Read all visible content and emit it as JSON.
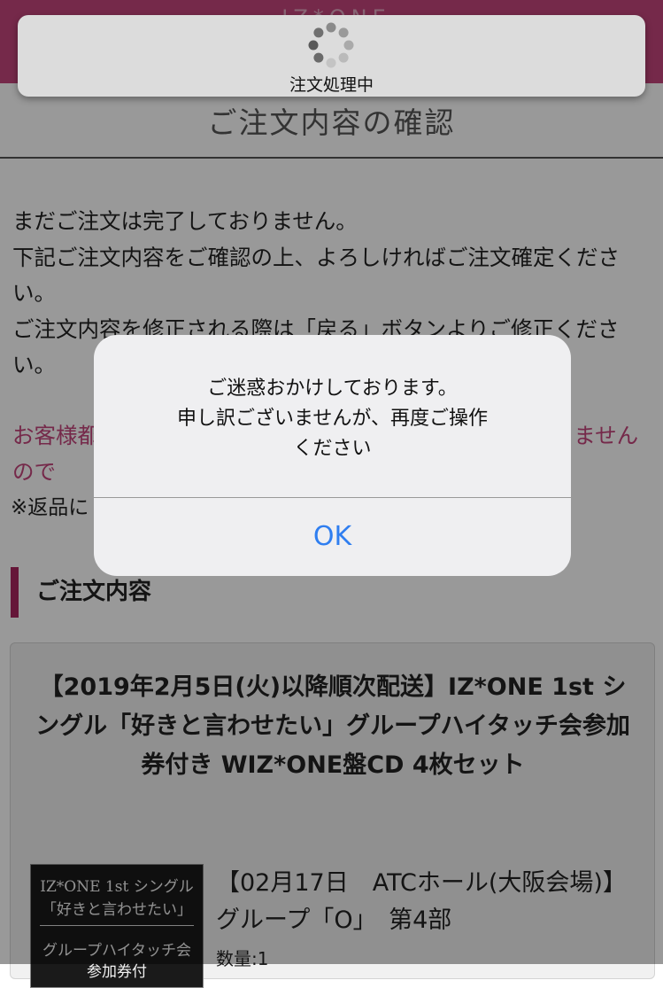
{
  "page": {
    "title": "ご注文内容の確認",
    "notice_lines": [
      "まだご注文は完了しておりません。",
      "下記ご注文内容をご確認の上、よろしければご注文確定ください。",
      "ご注文内容を修正される際は「戻る」ボタンよりご修正ください。"
    ],
    "warning_text": "お客様都合によるご注文の変更・キャンセルは承っておりませんので",
    "return_note": "※返品に",
    "section_heading": "ご注文内容"
  },
  "product": {
    "title": "【2019年2月5日(火)以降順次配送】IZ*ONE 1st シングル「好きと言わせたい」グループハイタッチ会参加券付き WIZ*ONE盤CD 4枚セット",
    "thumbnail_lines": [
      "IZ*ONE 1st シングル",
      "「好きと言わせたい」",
      "グループハイタッチ会",
      "参加券付"
    ],
    "event": "【02月17日　ATCホール(大阪会場)】グループ「O」　第4部",
    "quantity_label": "数量:",
    "quantity_value": "1"
  },
  "processing": {
    "label": "注文処理中",
    "icon": "spinner-icon"
  },
  "alert": {
    "message_lines": [
      "ご迷惑おかけしております。",
      "申し訳ございませんが、再度ご操作",
      "ください"
    ],
    "ok_label": "OK"
  },
  "colors": {
    "brand_pink": "#c4457c",
    "section_accent": "#a8265e",
    "ios_blue": "#2f7ef0"
  }
}
